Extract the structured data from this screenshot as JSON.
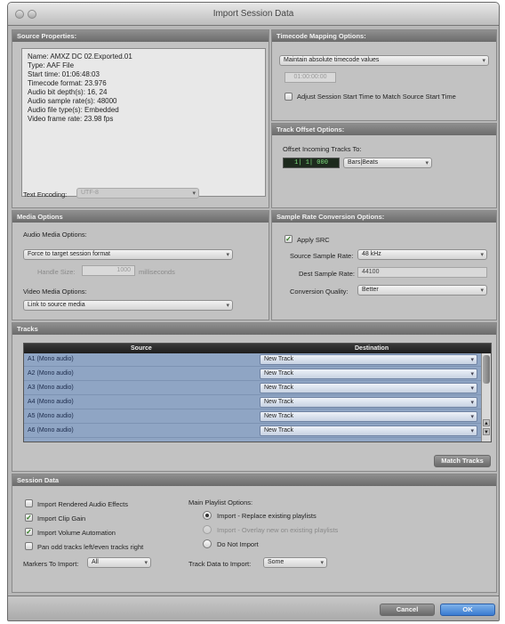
{
  "window": {
    "title": "Import Session Data"
  },
  "source_properties": {
    "header": "Source Properties:",
    "lines": [
      "Name: AMXZ DC 02.Exported.01",
      "Type: AAF File",
      "Start time: 01:06:48:03",
      "Timecode format: 23.976",
      "Audio bit depth(s): 16, 24",
      "Audio sample rate(s): 48000",
      "Audio file type(s): Embedded",
      "Video frame rate: 23.98 fps"
    ],
    "text_encoding_label": "Text Encoding:",
    "text_encoding_value": "UTF-8"
  },
  "timecode_mapping": {
    "header": "Timecode Mapping Options:",
    "mode_value": "Maintain absolute timecode values",
    "timecode_value": "01:00:00:00",
    "adjust_label": "Adjust Session Start Time to Match Source Start Time",
    "adjust_checked": false
  },
  "track_offset": {
    "header": "Track Offset Options:",
    "offset_label": "Offset Incoming Tracks To:",
    "offset_value": "1| 1| 000",
    "offset_unit": "Bars|Beats"
  },
  "media_options": {
    "header": "Media Options",
    "audio_label": "Audio Media Options:",
    "audio_value": "Force to target session format",
    "handle_label": "Handle Size:",
    "handle_value": "1000",
    "handle_unit": "milliseconds",
    "video_label": "Video Media Options:",
    "video_value": "Link to source media"
  },
  "src_options": {
    "header": "Sample Rate Conversion Options:",
    "apply_label": "Apply SRC",
    "apply_checked": true,
    "source_rate_label": "Source Sample Rate:",
    "source_rate_value": "48 kHz",
    "dest_rate_label": "Dest Sample Rate:",
    "dest_rate_value": "44100",
    "quality_label": "Conversion Quality:",
    "quality_value": "Better"
  },
  "tracks": {
    "header": "Tracks",
    "col_source": "Source",
    "col_destination": "Destination",
    "rows": [
      {
        "source": "A1 (Mono audio)",
        "destination": "New Track"
      },
      {
        "source": "A2 (Mono audio)",
        "destination": "New Track"
      },
      {
        "source": "A3 (Mono audio)",
        "destination": "New Track"
      },
      {
        "source": "A4 (Mono audio)",
        "destination": "New Track"
      },
      {
        "source": "A5 (Mono audio)",
        "destination": "New Track"
      },
      {
        "source": "A6 (Mono audio)",
        "destination": "New Track"
      }
    ],
    "match_button": "Match Tracks"
  },
  "session_data": {
    "header": "Session Data",
    "checks": [
      {
        "label": "Import Rendered Audio Effects",
        "checked": false
      },
      {
        "label": "Import Clip Gain",
        "checked": true
      },
      {
        "label": "Import Volume Automation",
        "checked": true
      },
      {
        "label": "Pan odd tracks left/even tracks right",
        "checked": false
      }
    ],
    "markers_label": "Markers To Import:",
    "markers_value": "All",
    "playlist_label": "Main Playlist Options:",
    "radio_replace": "Import - Replace existing playlists",
    "radio_overlay": "Import - Overlay new on existing playlists",
    "radio_none": "Do Not Import",
    "track_data_label": "Track Data to Import:",
    "track_data_value": "Some"
  },
  "footer": {
    "cancel": "Cancel",
    "ok": "OK"
  }
}
